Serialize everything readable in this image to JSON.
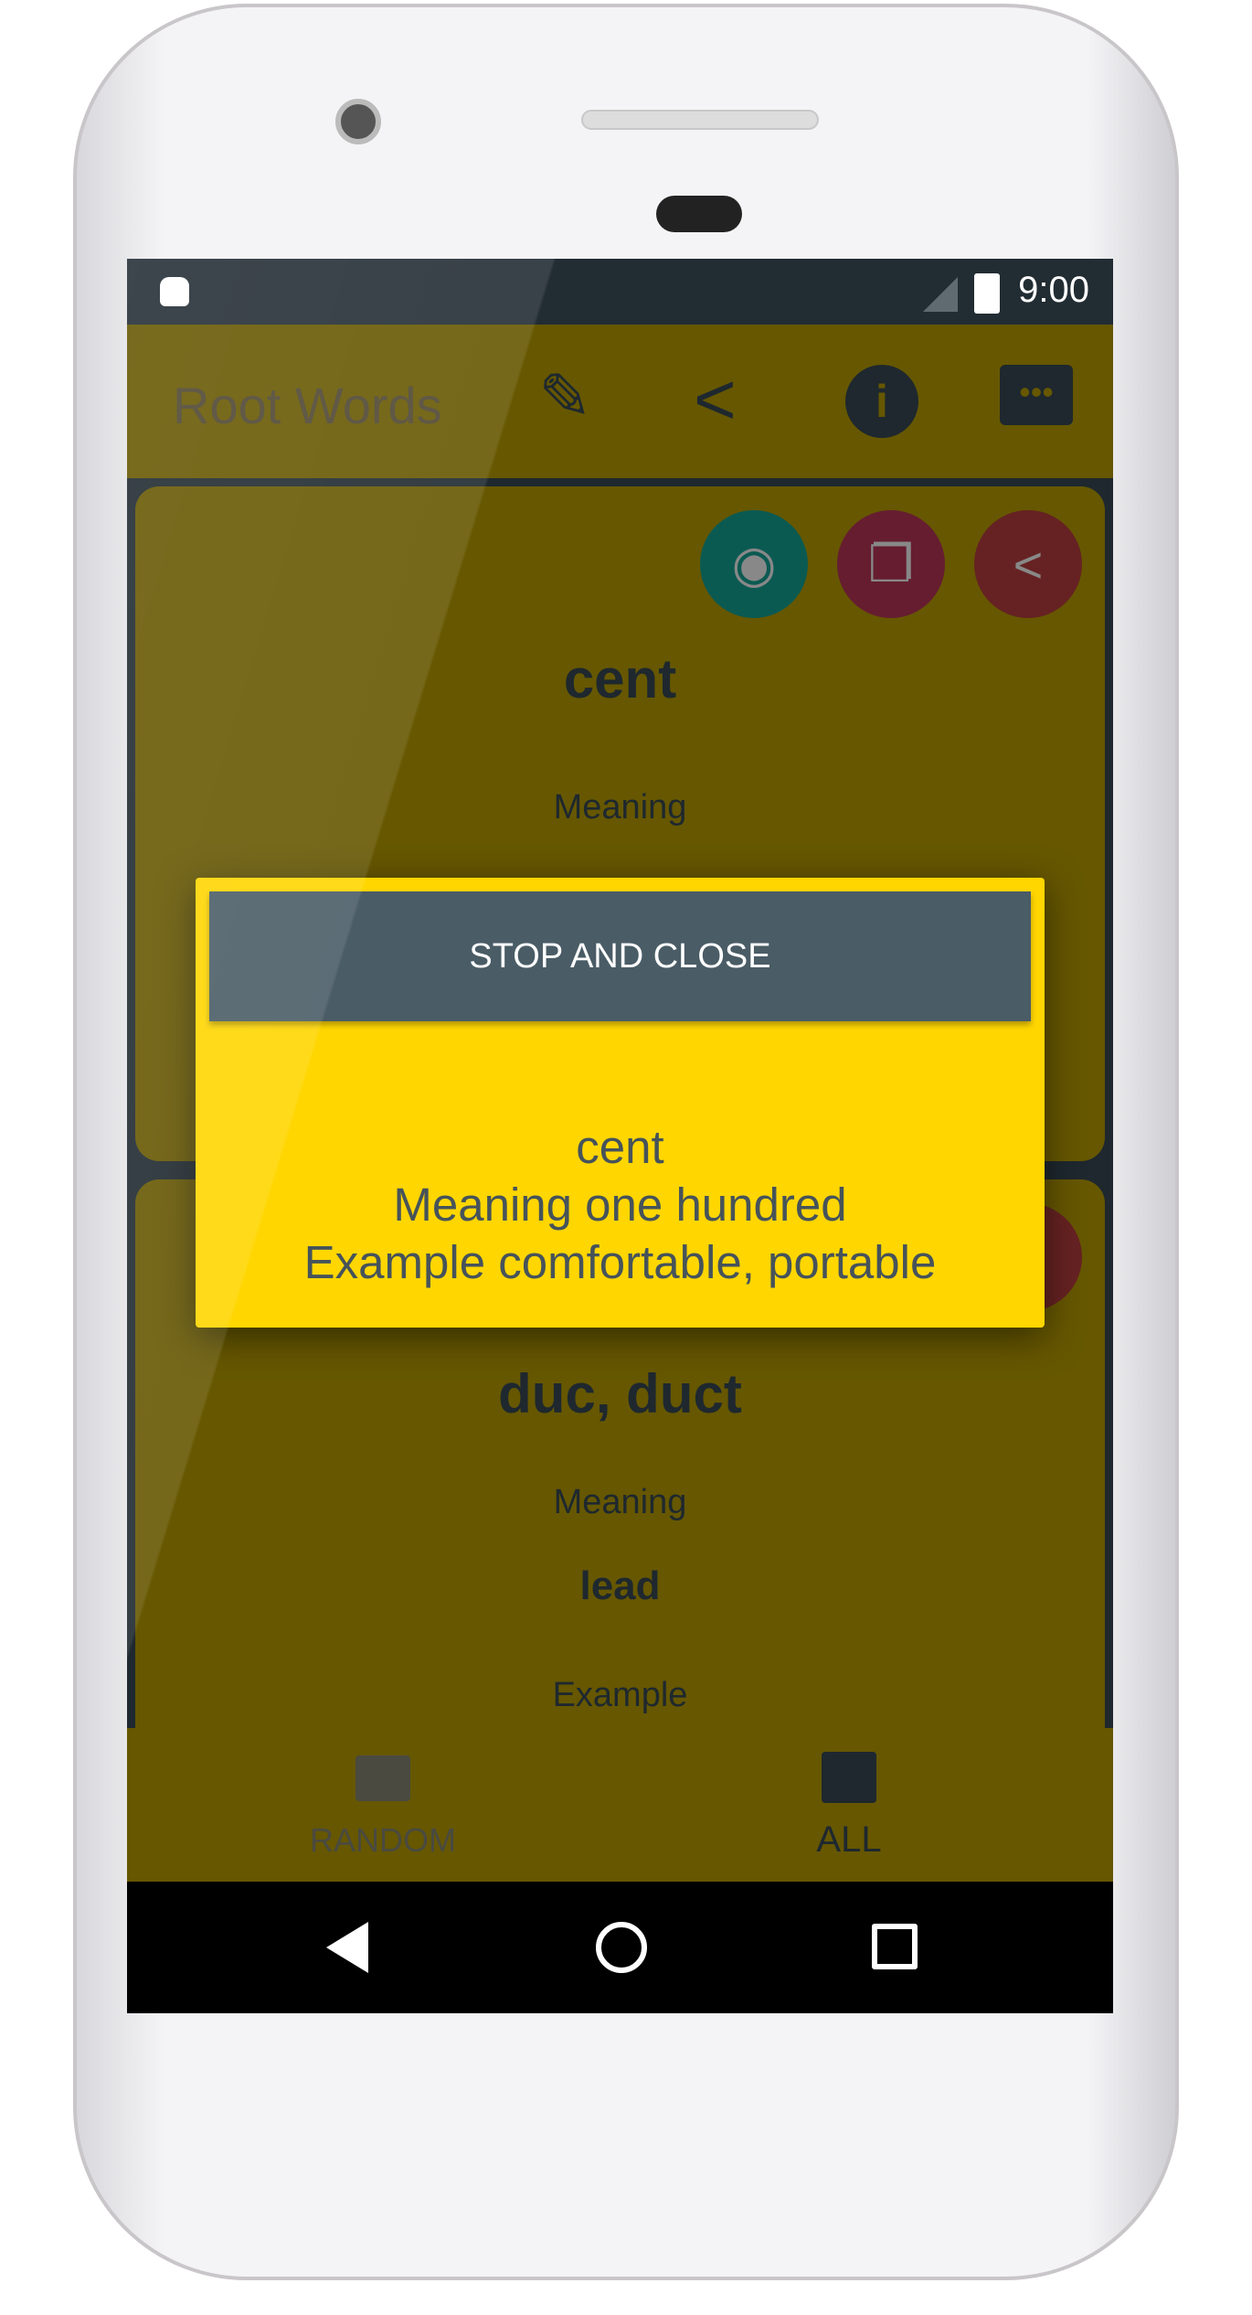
{
  "status": {
    "time": "9:00",
    "icons": [
      "android-icon",
      "signal-icon",
      "battery-charging-icon"
    ]
  },
  "appbar": {
    "title": "Root Words",
    "actions": [
      "rate-icon",
      "share-icon",
      "info-icon",
      "feedback-icon"
    ]
  },
  "cards": [
    {
      "word": "cent",
      "meaning_label": "Meaning",
      "actions": [
        "speak-icon",
        "copy-icon",
        "share-icon"
      ]
    },
    {
      "word": "duc, duct",
      "meaning_label": "Meaning",
      "meaning": "lead",
      "example_label": "Example"
    }
  ],
  "dialog": {
    "button": "STOP AND CLOSE",
    "word": "cent",
    "meaning": "Meaning one hundred",
    "example": "Example comfortable, portable",
    "color": "#ffd600"
  },
  "bottom_nav": [
    {
      "label": "RANDOM",
      "icon": "chat-icon",
      "active": false
    },
    {
      "label": "ALL",
      "icon": "forum-icon",
      "active": true
    }
  ],
  "navbar": [
    "back-icon",
    "home-icon",
    "recents-icon"
  ]
}
